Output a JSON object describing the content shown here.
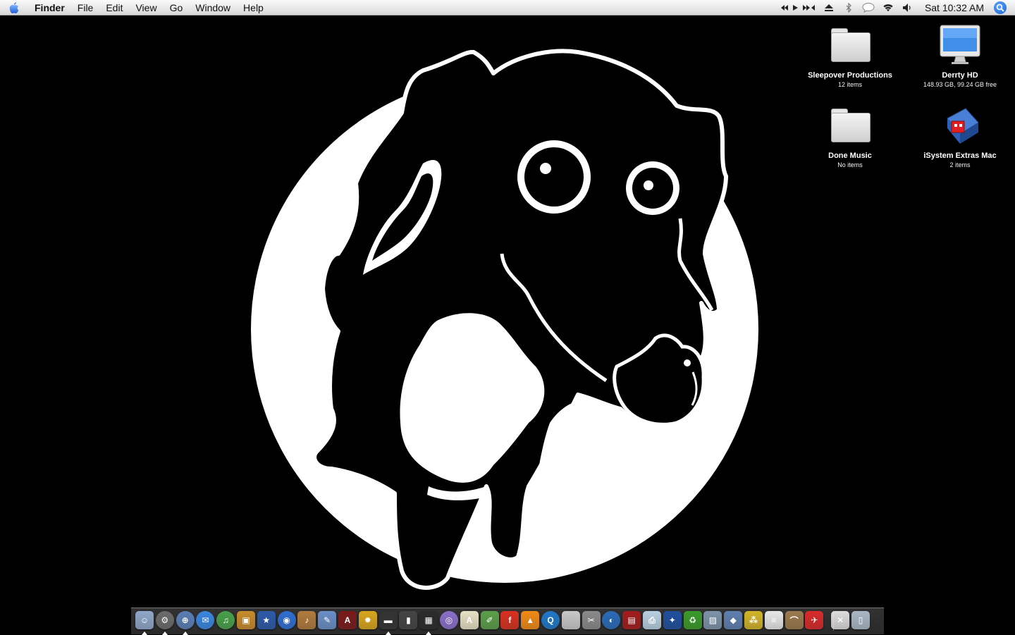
{
  "menubar": {
    "app_name": "Finder",
    "menus": [
      "File",
      "Edit",
      "View",
      "Go",
      "Window",
      "Help"
    ],
    "extras": [
      "itunes-controls-icon",
      "eject-icon",
      "bluetooth-icon",
      "ichat-status-icon",
      "wifi-icon",
      "volume-icon"
    ],
    "clock": "Sat 10:32 AM"
  },
  "desktop": {
    "icons": [
      {
        "label": "Sleepover Productions",
        "info": "12 items",
        "type": "folder"
      },
      {
        "label": "Derrty HD",
        "info": "148.93 GB, 99.24 GB free",
        "type": "hard-drive"
      },
      {
        "label": "Done Music",
        "info": "No items",
        "type": "folder"
      },
      {
        "label": "iSystem Extras Mac",
        "info": "2 items",
        "type": "package"
      }
    ]
  },
  "wallpaper": {
    "description_colors": {
      "background": "#000000",
      "circle": "#ffffff",
      "dog": "#000000"
    }
  },
  "dock": {
    "items": [
      {
        "name": "finder-icon",
        "color": "#8fa7c9",
        "glyph": "☺",
        "running": true
      },
      {
        "name": "system-preferences-icon",
        "color": "#6b6b6b",
        "glyph": "⚙",
        "running": true
      },
      {
        "name": "safari-icon",
        "color": "#5a7fb5",
        "glyph": "⊕",
        "running": true
      },
      {
        "name": "ichat-icon",
        "color": "#3a86e0",
        "glyph": "✉",
        "running": false
      },
      {
        "name": "itunes-icon",
        "color": "#48a04a",
        "glyph": "♫",
        "running": false
      },
      {
        "name": "iphoto-icon",
        "color": "#c78b2c",
        "glyph": "▣",
        "running": false
      },
      {
        "name": "imovie-icon",
        "color": "#2c5aa8",
        "glyph": "★",
        "running": false
      },
      {
        "name": "idvd-icon",
        "color": "#2f6ed1",
        "glyph": "◉",
        "running": false
      },
      {
        "name": "garageband-icon",
        "color": "#b07a3c",
        "glyph": "♪",
        "running": false
      },
      {
        "name": "iweb-icon",
        "color": "#6a8fc7",
        "glyph": "✎",
        "running": false
      },
      {
        "name": "americas-army-icon",
        "color": "#7a1a1a",
        "glyph": "A",
        "running": false
      },
      {
        "name": "burst-icon",
        "color": "#d8a51c",
        "glyph": "✹",
        "running": false
      },
      {
        "name": "dvd-player-icon",
        "color": "#333333",
        "glyph": "▬",
        "running": true
      },
      {
        "name": "video-app-icon",
        "color": "#444444",
        "glyph": "▮",
        "running": false
      },
      {
        "name": "clapper-icon",
        "color": "#2b2b2b",
        "glyph": "▦",
        "running": true
      },
      {
        "name": "dvd-studio-icon",
        "color": "#8a6ec9",
        "glyph": "◎",
        "running": false
      },
      {
        "name": "textedit-icon",
        "color": "#e6e0c4",
        "glyph": "A",
        "running": false
      },
      {
        "name": "script-editor-icon",
        "color": "#5c9e4a",
        "glyph": "✐",
        "running": false
      },
      {
        "name": "flash-icon",
        "color": "#d8301f",
        "glyph": "f",
        "running": false
      },
      {
        "name": "vlc-icon",
        "color": "#f08a16",
        "glyph": "▲",
        "running": false
      },
      {
        "name": "quicktime-icon",
        "color": "#1f78c8",
        "glyph": "Q",
        "running": false
      },
      {
        "name": "apple-app-icon",
        "color": "#c9c9c9",
        "glyph": "",
        "running": false
      },
      {
        "name": "tools-icon",
        "color": "#8a8a8a",
        "glyph": "✂",
        "running": false
      },
      {
        "name": "globe-icon",
        "color": "#2a6bb8",
        "glyph": "◐",
        "running": false
      },
      {
        "name": "film-strip-icon",
        "color": "#a21c1c",
        "glyph": "▤",
        "running": false
      },
      {
        "name": "printer-icon",
        "color": "#b8cfe0",
        "glyph": "⎙",
        "running": false
      },
      {
        "name": "blue-bird-icon",
        "color": "#1f4f9e",
        "glyph": "✦",
        "running": false
      },
      {
        "name": "recycle-icon",
        "color": "#3a9a2a",
        "glyph": "♻",
        "running": false
      },
      {
        "name": "photo-icon",
        "color": "#7d93a8",
        "glyph": "▨",
        "running": false
      },
      {
        "name": "network-icon",
        "color": "#5f7fb0",
        "glyph": "◆",
        "running": false
      },
      {
        "name": "bee-icon",
        "color": "#d2b428",
        "glyph": "⁂",
        "running": false
      },
      {
        "name": "document-icon",
        "color": "#e8e8e8",
        "glyph": "≡",
        "running": false
      },
      {
        "name": "hat-icon",
        "color": "#9b7a4c",
        "glyph": "⌒",
        "running": false
      },
      {
        "name": "red-app-icon",
        "color": "#d82a2a",
        "glyph": "✈",
        "running": false
      },
      {
        "name": "mail-stack-icon",
        "color": "#dcdcdc",
        "glyph": "✕",
        "running": false
      },
      {
        "name": "trash-icon",
        "color": "#a9b8c6",
        "glyph": "▯",
        "running": false
      }
    ]
  }
}
